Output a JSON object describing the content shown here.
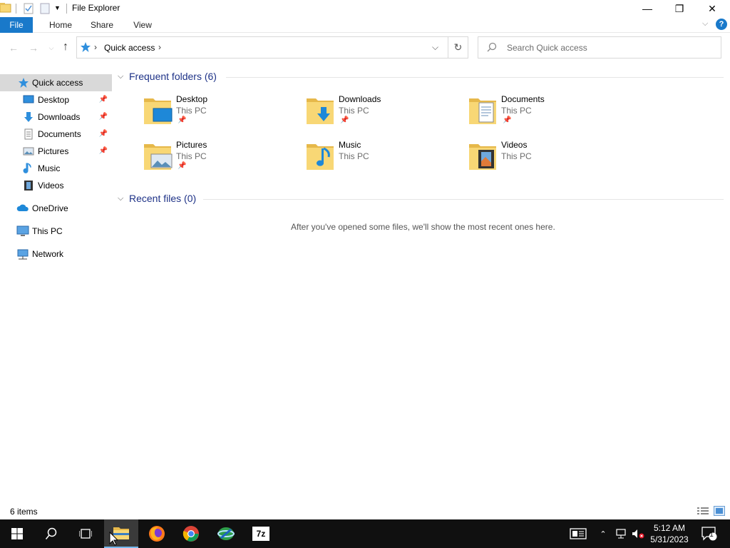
{
  "window": {
    "title": "File Explorer",
    "controls": {
      "minimize": "—",
      "maximize": "❐",
      "close": "✕"
    }
  },
  "ribbon": {
    "tabs": [
      {
        "label": "File",
        "active": true
      },
      {
        "label": "Home"
      },
      {
        "label": "Share"
      },
      {
        "label": "View"
      }
    ],
    "help": "?"
  },
  "address": {
    "path": [
      "Quick access"
    ],
    "separator": "›"
  },
  "search": {
    "placeholder": "Search Quick access"
  },
  "nav": {
    "items": [
      {
        "label": "Quick access",
        "icon": "star-icon",
        "selected": true
      },
      {
        "label": "Desktop",
        "icon": "desktop-icon",
        "pinned": true
      },
      {
        "label": "Downloads",
        "icon": "download-arrow-icon",
        "pinned": true
      },
      {
        "label": "Documents",
        "icon": "document-icon",
        "pinned": true
      },
      {
        "label": "Pictures",
        "icon": "picture-icon",
        "pinned": true
      },
      {
        "label": "Music",
        "icon": "music-note-icon"
      },
      {
        "label": "Videos",
        "icon": "film-icon"
      },
      {
        "label": "OneDrive",
        "icon": "cloud-icon"
      },
      {
        "label": "This PC",
        "icon": "computer-icon"
      },
      {
        "label": "Network",
        "icon": "network-icon"
      }
    ]
  },
  "frequent": {
    "heading": "Frequent folders (6)",
    "folders": [
      {
        "name": "Desktop",
        "location": "This PC",
        "pinned": true,
        "icon": "desktop-folder-icon"
      },
      {
        "name": "Downloads",
        "location": "This PC",
        "pinned": true,
        "icon": "downloads-folder-icon"
      },
      {
        "name": "Documents",
        "location": "This PC",
        "pinned": true,
        "icon": "documents-folder-icon"
      },
      {
        "name": "Pictures",
        "location": "This PC",
        "pinned": true,
        "icon": "pictures-folder-icon"
      },
      {
        "name": "Music",
        "location": "This PC",
        "pinned": false,
        "icon": "music-folder-icon"
      },
      {
        "name": "Videos",
        "location": "This PC",
        "pinned": false,
        "icon": "videos-folder-icon"
      }
    ]
  },
  "recent": {
    "heading": "Recent files (0)",
    "empty_message": "After you've opened some files, we'll show the most recent ones here."
  },
  "status": {
    "item_count": "6 items"
  },
  "taskbar": {
    "apps": [
      {
        "name": "start",
        "icon": "windows-logo-icon"
      },
      {
        "name": "search",
        "icon": "search-icon"
      },
      {
        "name": "task-view",
        "icon": "task-view-icon"
      },
      {
        "name": "file-explorer",
        "icon": "folder-icon",
        "active": true
      },
      {
        "name": "firefox",
        "icon": "firefox-icon"
      },
      {
        "name": "chrome",
        "icon": "chrome-icon"
      },
      {
        "name": "network-app",
        "icon": "globe-icon"
      },
      {
        "name": "7zip",
        "icon": "7zip-icon",
        "label": "7z"
      }
    ],
    "time": "5:12 AM",
    "date": "5/31/2023",
    "notifications": "1"
  },
  "colors": {
    "accent": "#1979ca",
    "heading": "#1e3287",
    "folder": "#f8d775",
    "taskbar": "#101010"
  }
}
